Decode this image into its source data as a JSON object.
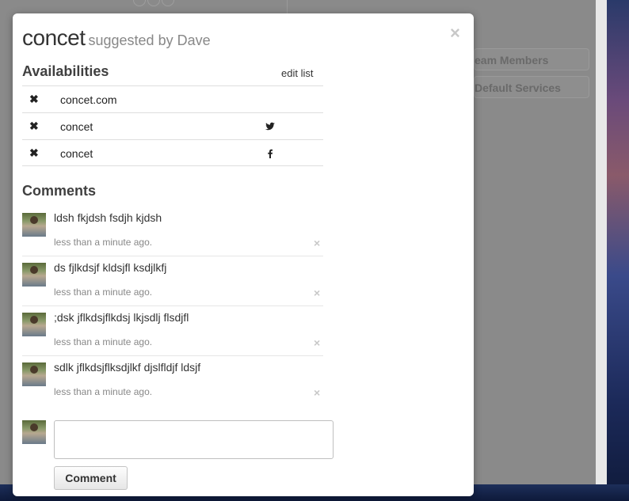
{
  "background": {
    "panel_items": [
      "eam Members",
      "Default Services"
    ]
  },
  "modal": {
    "title": "concet",
    "subtitle": "suggested by Dave",
    "close_icon": "close-icon",
    "availabilities": {
      "heading": "Availabilities",
      "edit_label": "edit list",
      "rows": [
        {
          "name": "concet.com",
          "status_icon": "x-icon",
          "service_icon": ""
        },
        {
          "name": "concet",
          "status_icon": "x-icon",
          "service_icon": "twitter-icon"
        },
        {
          "name": "concet",
          "status_icon": "x-icon",
          "service_icon": "facebook-icon"
        }
      ]
    },
    "comments": {
      "heading": "Comments",
      "items": [
        {
          "text": "ldsh fkjdsh fsdjh kjdsh",
          "time": "less than a minute ago."
        },
        {
          "text": "ds fjlkdsjf kldsjfl ksdjlkfj",
          "time": "less than a minute ago."
        },
        {
          "text": ";dsk jflkdsjflkdsj lkjsdlj flsdjfl",
          "time": "less than a minute ago."
        },
        {
          "text": "sdlk jflkdsjflksdjlkf djslfldjf ldsjf",
          "time": "less than a minute ago."
        }
      ],
      "input_value": "",
      "submit_label": "Comment"
    }
  }
}
